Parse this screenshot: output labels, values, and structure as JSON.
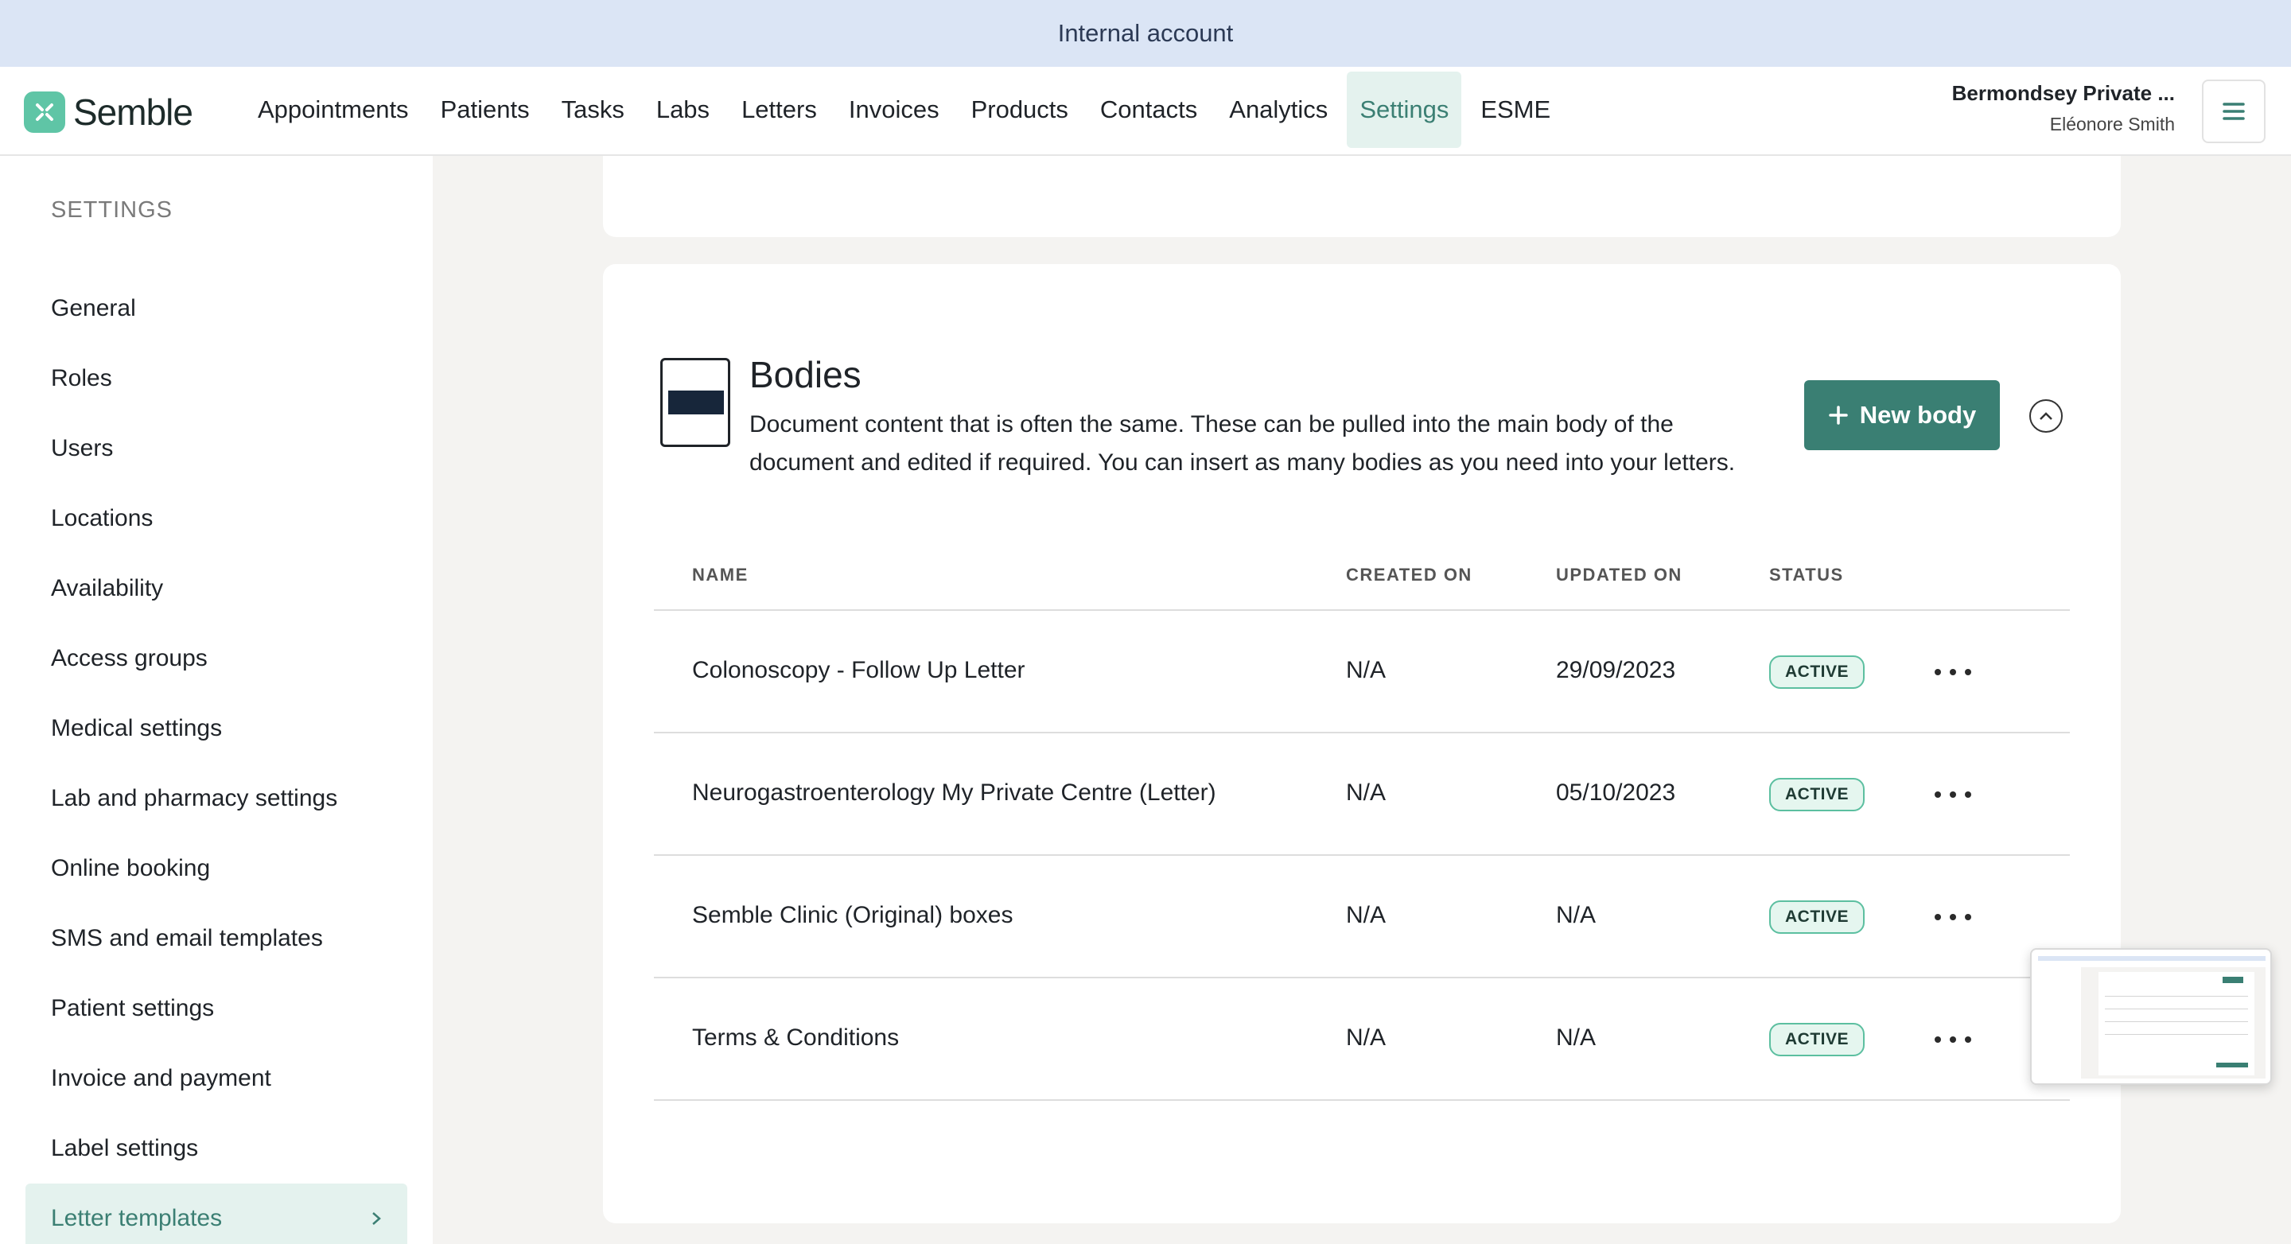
{
  "banner": {
    "text": "Internal account"
  },
  "brand": {
    "name": "Semble",
    "accent": "#3a7f73",
    "logo_color": "#5fc5a6"
  },
  "nav": {
    "items": [
      "Appointments",
      "Patients",
      "Tasks",
      "Labs",
      "Letters",
      "Invoices",
      "Products",
      "Contacts",
      "Analytics",
      "Settings",
      "ESME"
    ],
    "active": "Settings"
  },
  "account": {
    "org": "Bermondsey Private ...",
    "user": "Eléonore Smith"
  },
  "sidebar": {
    "title": "SETTINGS",
    "items": [
      {
        "label": "General"
      },
      {
        "label": "Roles"
      },
      {
        "label": "Users"
      },
      {
        "label": "Locations"
      },
      {
        "label": "Availability"
      },
      {
        "label": "Access groups"
      },
      {
        "label": "Medical settings"
      },
      {
        "label": "Lab and pharmacy settings"
      },
      {
        "label": "Online booking"
      },
      {
        "label": "SMS and email templates"
      },
      {
        "label": "Patient settings"
      },
      {
        "label": "Invoice and payment"
      },
      {
        "label": "Label settings"
      },
      {
        "label": "Letter templates"
      }
    ],
    "active": "Letter templates"
  },
  "section": {
    "title": "Bodies",
    "description": "Document content that is often the same. These can be pulled into the main body of the document and edited if required. You can insert as many bodies as you need into your letters.",
    "new_button": "New body",
    "icons": {
      "document": "document-icon",
      "collapse": "chevron-up-circle-icon",
      "add": "plus-icon",
      "more": "more-horizontal-icon"
    }
  },
  "table": {
    "headers": {
      "name": "NAME",
      "created": "CREATED ON",
      "updated": "UPDATED ON",
      "status": "STATUS"
    },
    "rows": [
      {
        "name": "Colonoscopy - Follow Up Letter",
        "created": "N/A",
        "updated": "29/09/2023",
        "status": "ACTIVE"
      },
      {
        "name": "Neurogastroenterology My Private Centre (Letter)",
        "created": "N/A",
        "updated": "05/10/2023",
        "status": "ACTIVE"
      },
      {
        "name": "Semble Clinic (Original) boxes",
        "created": "N/A",
        "updated": "N/A",
        "status": "ACTIVE"
      },
      {
        "name": "Terms & Conditions",
        "created": "N/A",
        "updated": "N/A",
        "status": "ACTIVE"
      }
    ]
  }
}
